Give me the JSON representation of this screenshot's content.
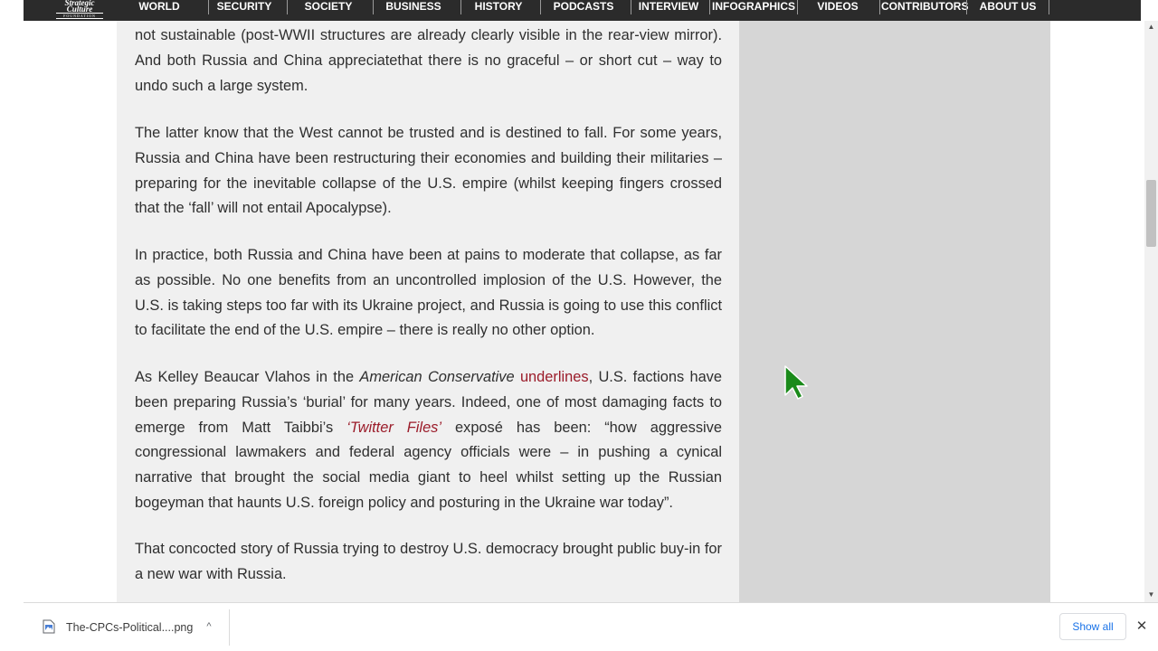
{
  "site": {
    "logo_line1": "Strategic",
    "logo_line2": "Culture",
    "logo_line3": "FOUNDATION"
  },
  "nav": {
    "items": [
      "WORLD",
      "SECURITY",
      "SOCIETY",
      "BUSINESS",
      "HISTORY",
      "PODCASTS",
      "INTERVIEW",
      "INFOGRAPHICS",
      "VIDEOS",
      "CONTRIBUTORS",
      "ABOUT US"
    ]
  },
  "article": {
    "p1": "not sustainable (post-WWII structures are already clearly visible in the rear-view mirror). And both Russia and China appreciatethat there is no graceful – or short cut – way to undo such a large system.",
    "p2": "The latter know that the West cannot be trusted and is destined to fall. For some years, Russia and China have been restructuring their economies and building their militaries – preparing for the inevitable collapse of the U.S. empire (whilst keeping fingers crossed that the ‘fall’ will not entail Apocalypse).",
    "p3": "In practice, both Russia and China have been at pains to moderate that collapse, as far as possible. No one benefits from an uncontrolled implosion of the U.S. However, the U.S. is taking steps too far with its Ukraine project, and Russia is going to use this conflict to facilitate the end of the U.S. empire – there is really no other option.",
    "p4": {
      "t1": "As Kelley Beaucar Vlahos in the ",
      "em1": "American Conservative",
      "t2": " ",
      "link1": "underlines",
      "t3": ", U.S. factions have been preparing Russia’s ‘burial’ for many years. Indeed, one of most damaging facts to emerge from Matt Taibbi’s ",
      "link2": "‘Twitter Files’",
      "t4": " exposé has been: “how aggressive congressional lawmakers and federal agency officials were – in pushing a cynical narrative that brought the social media giant to heel whilst setting up the Russian bogeyman that haunts U.S. foreign policy and posturing in the Ukraine war today”."
    },
    "p5": "That concocted story of Russia trying to destroy U.S. democracy brought public buy-in for a new war with Russia."
  },
  "downloads": {
    "filename": "The-CPCs-Political....png",
    "show_all": "Show all",
    "close": "✕",
    "chevron": "^"
  },
  "colors": {
    "nav_bg": "#2b2b2b",
    "article_bg": "#f0f0f0",
    "sidebar_bg": "#d6d6d6",
    "link": "#9b1c2a",
    "cursor": "#1a8a1a",
    "show_all": "#1a73e8"
  },
  "icons": {
    "cursor": "arrow-cursor-icon",
    "file": "image-file-icon",
    "chevron": "chevron-up-icon",
    "close": "close-icon"
  }
}
